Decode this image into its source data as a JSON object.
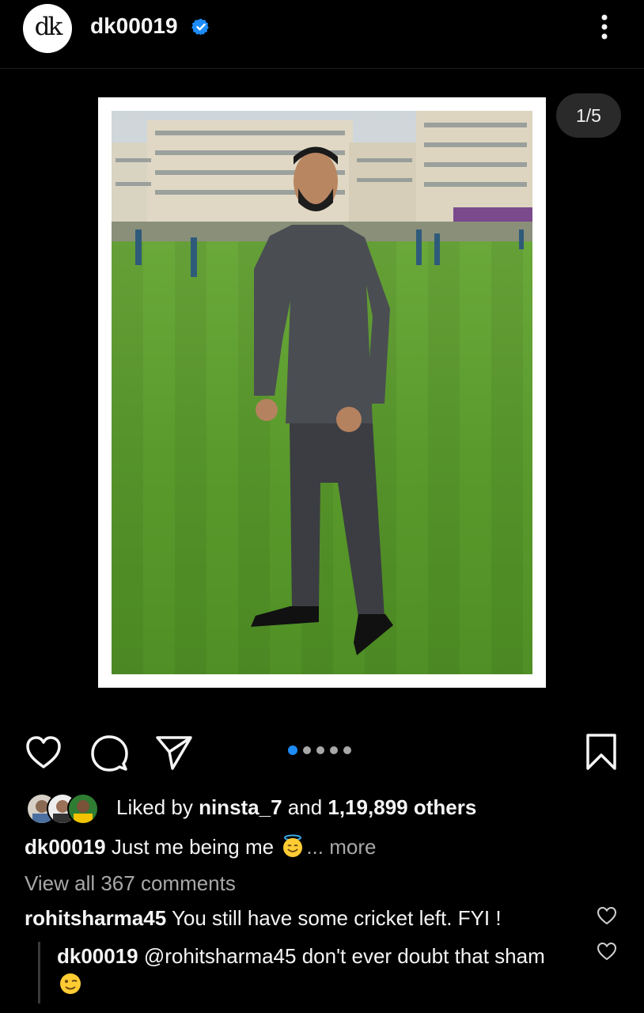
{
  "post": {
    "username": "dk00019",
    "avatar_initials": "dk",
    "verified_icon": "verified-badge-icon",
    "carousel_counter": "1/5",
    "carousel_total": 5,
    "carousel_current": 1
  },
  "actions": {
    "like_icon": "heart-icon",
    "comment_icon": "comment-icon",
    "share_icon": "send-icon",
    "save_icon": "bookmark-icon"
  },
  "likes": {
    "prefix": "Liked by ",
    "first_liker": "ninsta_7",
    "middle": " and ",
    "count": "1,19,899 others"
  },
  "caption": {
    "username": "dk00019",
    "text": " Just me being me ",
    "emoji": "smiling-face-with-halo",
    "more": "... more"
  },
  "comments": {
    "view_all": "View all 367 comments",
    "items": [
      {
        "username": "rohitsharma45",
        "text": " You still have some cricket left. FYI !"
      }
    ],
    "reply": {
      "username": "dk00019",
      "mention": " @rohitsharma45",
      "text": " don't ever doubt that sham ",
      "emoji": "winking-face"
    }
  },
  "colors": {
    "accent_blue": "#1d8cf8",
    "background": "#000000",
    "text_primary": "#f5f5f5",
    "text_muted": "#a8a8a8"
  }
}
